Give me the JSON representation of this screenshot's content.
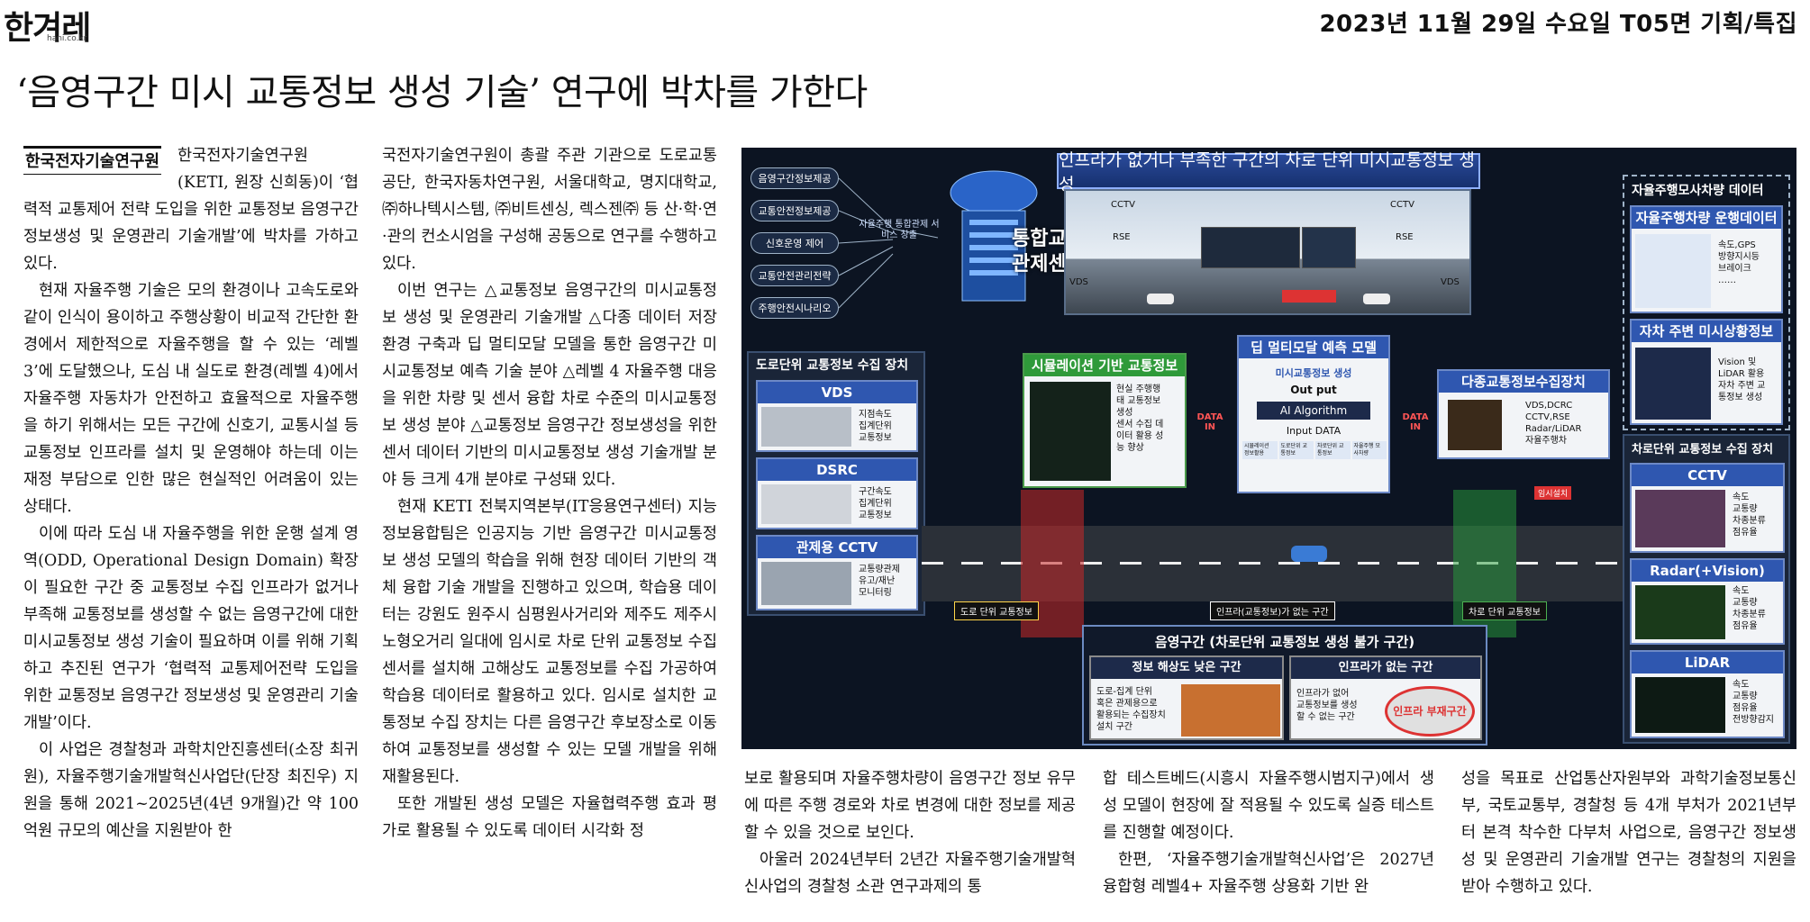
{
  "masthead": {
    "logo": "한겨레",
    "logo_sub": "hani.co.kr",
    "dateline": "2023년 11월 29일 수요일 T05면 기획/특집"
  },
  "headline": "‘음영구간 미시 교통정보 생성 기술’ 연구에 박차를 가한다",
  "byline": "한국전자기술연구원",
  "col1": [
    "한국전자기술연구원(KETI, 원장 신희동)이 ‘협력적 교통제어 전략 도입을 위한 교통정보 음영구간 정보생성 및 운영관리 기술개발’에 박차를 가하고 있다.",
    "현재 자율주행 기술은 모의 환경이나 고속도로와 같이 인식이 용이하고 주행상황이 비교적 간단한 환경에서 제한적으로 자율주행을 할 수 있는 ‘레벨 3’에 도달했으나, 도심 내 실도로 환경(레벨 4)에서 자율주행 자동차가 안전하고 효율적으로 자율주행을 하기 위해서는 모든 구간에 신호기, 교통시설 등 교통정보 인프라를 설치 및 운영해야 하는데 이는 재정 부담으로 인한 많은 현실적인 어려움이 있는 상태다.",
    "이에 따라 도심 내 자율주행을 위한 운행 설계 영역(ODD, Operational Design Domain) 확장이 필요한 구간 중 교통정보 수집 인프라가 없거나 부족해 교통정보를 생성할 수 없는 음영구간에 대한 미시교통정보 생성 기술이 필요하며 이를 위해 기획하고 추진된 연구가 ‘협력적 교통제어전략 도입을 위한 교통정보 음영구간 정보생성 및 운영관리 기술개발’이다.",
    "이 사업은 경찰청과 과학치안진흥센터(소장 최귀원), 자율주행기술개발혁신사업단(단장 최진우) 지원을 통해 2021~2025년(4년 9개월)간 약 100억원 규모의 예산을 지원받아 한"
  ],
  "col2": [
    "국전자기술연구원이 총괄 주관 기관으로 도로교통공단, 한국자동차연구원, 서울대학교, 명지대학교, ㈜하나텍시스템, ㈜비트센싱, 렉스젠㈜ 등 산·학·연·관의 컨소시엄을 구성해 공동으로 연구를 수행하고 있다.",
    "이번 연구는 △교통정보 음영구간의 미시교통정보 생성 및 운영관리 기술개발 △다종 데이터 저장환경 구축과 딥 멀티모달 모델을 통한 음영구간 미시교통정보 예측 기술 분야 △레벨 4 자율주행 대응을 위한 차량 및 센서 융합 차로 수준의 미시교통정보 생성 분야 △교통정보 음영구간 정보생성을 위한 센서 데이터 기반의 미시교통정보 생성 기술개발 분야 등 크게 4개 분야로 구성돼 있다.",
    "현재 KETI 전북지역본부(IT응용연구센터) 지능정보융합팀은 인공지능 기반 음영구간 미시교통정보 생성 모델의 학습을 위해 현장 데이터 기반의 객체 융합 기술 개발을 진행하고 있으며, 학습용 데이터는 강원도 원주시 심평원사거리와 제주도 제주시 노형오거리 일대에 임시로 차로 단위 교통정보 수집 센서를 설치해 고해상도 교통정보를 수집 가공하여 학습용 데이터로 활용하고 있다. 임시로 설치한 교통정보 수집 장치는 다른 음영구간 후보장소로 이동하여 교통정보를 생성할 수 있는 모델 개발을 위해 재활용된다.",
    "또한 개발된 생성 모델은 자율협력주행 효과 평가로 활용될 수 있도록 데이터 시각화 정"
  ],
  "col3": [
    "보로 활용되며 자율주행차량이 음영구간 정보 유무에 따른 주행 경로와 차로 변경에 대한 정보를 제공할 수 있을 것으로 보인다.",
    "아울러 2024년부터 2년간 자율주행기술개발혁신사업의 경찰청 소관 연구과제의 통"
  ],
  "col4": [
    "합 테스트베드(시흥시 자율주행시범지구)에서 생성 모델이 현장에 잘 적용될 수 있도록 실증 테스트를 진행할 예정이다.",
    "한편, ‘자율주행기술개발혁신사업’은 2027년 융합형 레벨4+ 자율주행 상용화 기반 완"
  ],
  "col5": [
    "성을 목표로 산업통산자원부와 과학기술정보통신부, 국토교통부, 경찰청 등 4개 부처가 2021년부터 본격 착수한 다부처 사업으로, 음영구간 정보생성 및 운영관리 기술개발 연구는 경찰청의 지원을 받아 수행하고 있다."
  ],
  "infographic": {
    "banner": "인프라가 없거나 부족한 구간의 차로 단위 미시교통정보 생성",
    "services": [
      "음영구간정보제공",
      "교통안전정보제공",
      "신호운영 제어",
      "교통안전관리전략",
      "주행안전시나리오"
    ],
    "center_overlay": "자율주행 통합관제 서비스 창출",
    "center_title_1": "통합교통",
    "center_title_2": "관제센터",
    "scene_labels": [
      "CCTV",
      "RSE",
      "VDS",
      "CCTV",
      "RSE",
      "VDS"
    ],
    "right_top_head": "자율주행모사차량 데이터",
    "right_card1_head": "자율주행차량 운행데이터",
    "right_card1_items": [
      "속도,GPS",
      "방향지시등",
      "브레이크",
      "……"
    ],
    "right_card2_head": "자차 주변 미시상황정보",
    "right_card2_items": [
      "Vision 및",
      "LiDAR 활용",
      "자차 주변 교",
      "통정보 생성"
    ],
    "road_head": "도로단위 교통정보 수집 장치",
    "road_cards": [
      {
        "head": "VDS",
        "items": [
          "지점속도",
          "집계단위",
          "교통정보"
        ]
      },
      {
        "head": "DSRC",
        "items": [
          "구간속도",
          "집계단위",
          "교통정보"
        ]
      },
      {
        "head": "관제용 CCTV",
        "items": [
          "교통량관제",
          "유고/재난",
          "모니터링"
        ]
      }
    ],
    "sim_head": "시뮬레이션 기반 교통정보",
    "sim_items": [
      "현실 주행행",
      "태 교통정보",
      "생성",
      "센서 수집 데",
      "이터 활용 성",
      "능 향상"
    ],
    "deep_head": "딥 멀티모달 예측 모델",
    "deep_label": "미시교통정보 생성",
    "deep_output": "Out put",
    "deep_algo": "AI Algorithm",
    "deep_input": "Input DATA",
    "deep_inputs": [
      "시뮬레이션 정보활용",
      "도로단위 교통정보",
      "차로단위 교통정보",
      "자율주행 모사차량"
    ],
    "data_in": "DATA IN",
    "multi_head": "다종교통정보수집장치",
    "multi_items": [
      "VDS,DCRC",
      "CCTV,RSE",
      "Radar/LiDAR",
      "자율주행차"
    ],
    "lane_head": "차로단위 교통정보 수집 장치",
    "lane_cards": [
      {
        "head": "CCTV",
        "items": [
          "속도",
          "교통량",
          "차종분류",
          "점유율"
        ]
      },
      {
        "head": "Radar(+Vision)",
        "items": [
          "속도",
          "교통량",
          "차종분류",
          "점유율"
        ]
      },
      {
        "head": "LiDAR",
        "items": [
          "속도",
          "교통량",
          "점유율",
          "전방향감지"
        ]
      }
    ],
    "road_labels": [
      "도로 단위 교통정보",
      "인프라(교통정보)가 없는 구간",
      "차로 단위 교통정보",
      "임시설치"
    ],
    "shadow_head": "음영구간 (차로단위 교통정보 생성 불가 구간)",
    "shadow_left_head": "정보 해상도 낮은 구간",
    "shadow_left_items": [
      "도로-집계 단위",
      "혹은 관제용으로",
      "활용되는 수집장치",
      "설치 구간"
    ],
    "shadow_right_head": "인프라가 없는 구간",
    "shadow_right_items": [
      "인프라가 없어",
      "교통정보를 생성",
      "할 수 없는 구간"
    ],
    "shadow_circle": "인프라 부재구간",
    "colors": {
      "navy": "#0c1422",
      "accent_blue": "#2f57b0",
      "yellow": "#ffd54a",
      "red": "#ff3b3b",
      "green": "#2f9a3a"
    }
  }
}
